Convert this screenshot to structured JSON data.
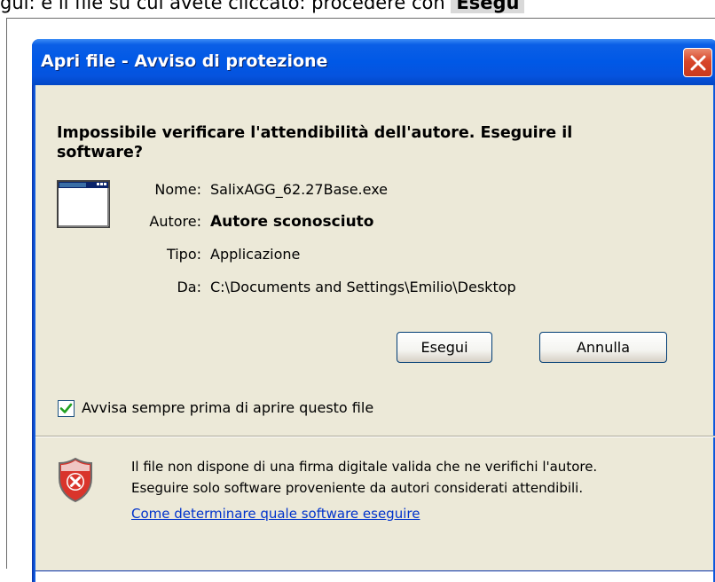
{
  "page_caption": {
    "text": "gui: è il file su cui avete cliccato: procedere con",
    "highlight": "Esegu"
  },
  "dialog": {
    "title": "Apri file - Avviso di protezione",
    "heading": "Impossibile verificare l'attendibilità dell'autore. Eseguire il software?",
    "fields": {
      "name": {
        "label": "Nome:",
        "value": "SalixAGG_62.27Base.exe"
      },
      "author": {
        "label": "Autore:",
        "value": "Autore sconosciuto"
      },
      "type": {
        "label": "Tipo:",
        "value": "Applicazione"
      },
      "from": {
        "label": "Da:",
        "value": "C:\\Documents and Settings\\Emilio\\Desktop"
      }
    },
    "buttons": {
      "run": "Esegui",
      "cancel": "Annulla"
    },
    "checkbox": {
      "label": "Avvisa sempre prima di aprire questo file",
      "checked": true
    },
    "info": {
      "line1": "Il file non dispone di una firma digitale valida che ne verifichi l'autore.",
      "line2": "Eseguire solo software proveniente da autori considerati attendibili.",
      "link": "Come determinare quale software eseguire"
    },
    "icons": {
      "close": "close-icon",
      "app": "application-window-icon",
      "shield": "security-warning-shield-icon",
      "check": "checkmark-icon"
    },
    "colors": {
      "titlebar": "#0058e6",
      "face": "#ece9d8",
      "link": "#0033cc",
      "close": "#d8462a"
    }
  }
}
